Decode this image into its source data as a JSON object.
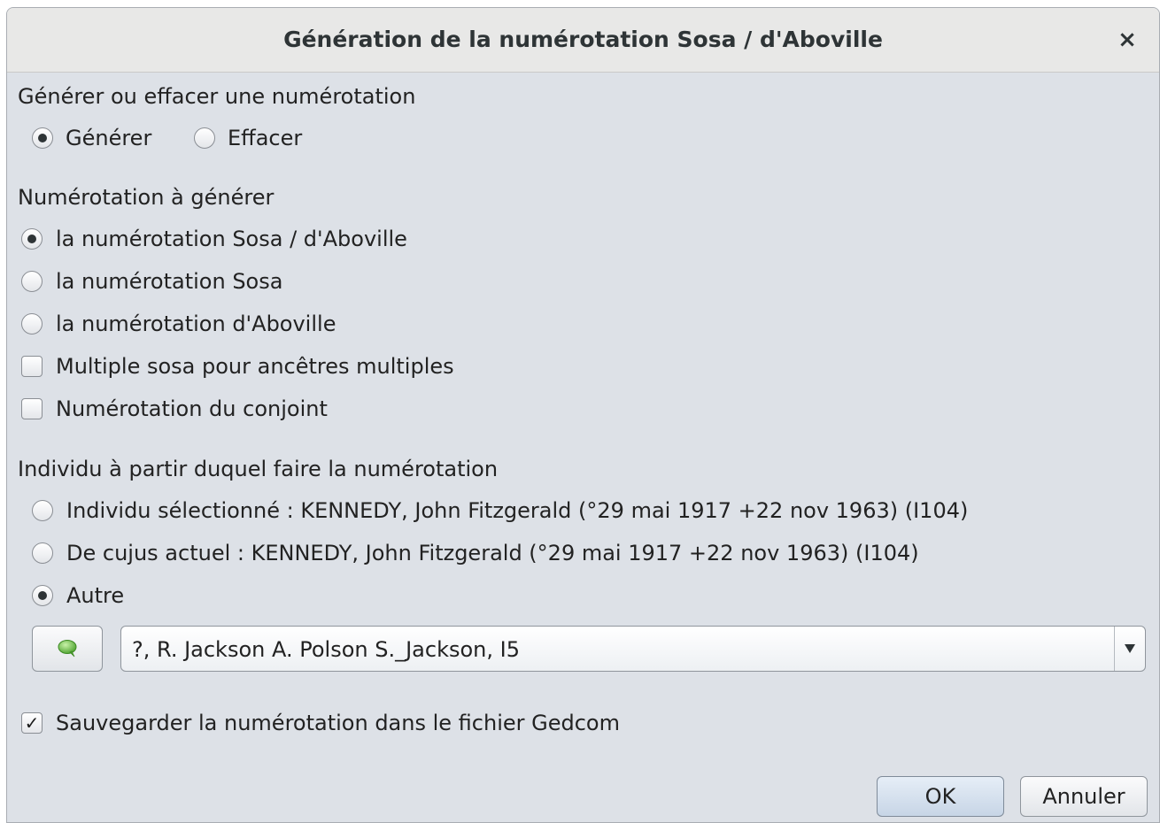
{
  "window": {
    "title": "Génération de la numérotation Sosa / d'Aboville",
    "close_icon": "×"
  },
  "mode_section": {
    "heading": "Générer ou effacer une numérotation",
    "options": [
      {
        "label": "Générer",
        "checked": true
      },
      {
        "label": "Effacer",
        "checked": false
      }
    ]
  },
  "numbering_section": {
    "heading": "Numérotation à générer",
    "radios": [
      {
        "label": "la numérotation Sosa / d'Aboville",
        "checked": true
      },
      {
        "label": "la numérotation Sosa",
        "checked": false
      },
      {
        "label": "la numérotation d'Aboville",
        "checked": false
      }
    ],
    "checkboxes": [
      {
        "label": "Multiple sosa pour ancêtres multiples",
        "checked": false
      },
      {
        "label": "Numérotation du conjoint",
        "checked": false
      }
    ]
  },
  "individual_section": {
    "heading": "Individu à partir duquel faire la numérotation",
    "radios": [
      {
        "label": "Individu sélectionné : KENNEDY, John Fitzgerald (°29 mai 1917 +22 nov 1963) (I104)",
        "checked": false
      },
      {
        "label": "De cujus actuel : KENNEDY, John Fitzgerald (°29 mai 1917 +22 nov 1963) (I104)",
        "checked": false
      },
      {
        "label": "Autre",
        "checked": true
      }
    ],
    "search_button_icon": "speech-bubble-icon",
    "combo_value": "?, R. Jackson A. Polson S._Jackson, I5",
    "combo_arrow": "▼"
  },
  "save_checkbox": {
    "label": "Sauvegarder la numérotation dans le fichier Gedcom",
    "checked": true,
    "mark": "✓"
  },
  "buttons": {
    "ok": "OK",
    "cancel": "Annuler"
  },
  "colors": {
    "dialog_bg": "#dde1e7",
    "titlebar_bg": "#e8e8e7",
    "ok_button": "#c7d5e6",
    "search_icon_green": "#6cc04a"
  }
}
